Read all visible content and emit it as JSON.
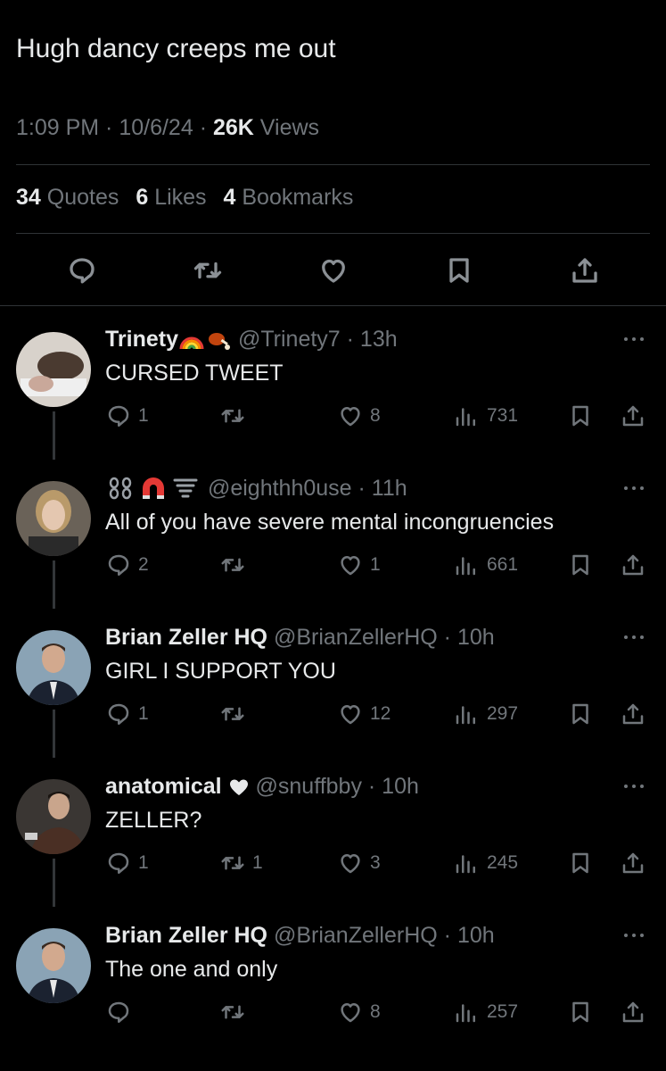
{
  "tweet": {
    "text": "Hugh dancy creeps me out",
    "time": "1:09 PM",
    "date": "10/6/24",
    "views_count": "26K",
    "views_label": "Views",
    "quotes_count": "34",
    "quotes_label": "Quotes",
    "likes_count": "6",
    "likes_label": "Likes",
    "bookmarks_count": "4",
    "bookmarks_label": "Bookmarks"
  },
  "replies": [
    {
      "name": "Trinety",
      "handle": "@Trinety7",
      "age": "13h",
      "text": "CURSED TWEET",
      "replies": "1",
      "reposts": "",
      "likes": "8",
      "views": "731",
      "name_emojis": [
        "rainbow",
        "meat-on-bone"
      ]
    },
    {
      "name": "",
      "handle": "@eighthh0use",
      "age": "11h",
      "text": "All of you have severe mental incongruencies",
      "replies": "2",
      "reposts": "",
      "likes": "1",
      "views": "661",
      "name_emojis": [
        "chains",
        "magnet",
        "tornado"
      ]
    },
    {
      "name": "Brian Zeller HQ",
      "handle": "@BrianZellerHQ",
      "age": "10h",
      "text": "GIRL I SUPPORT YOU",
      "replies": "1",
      "reposts": "",
      "likes": "12",
      "views": "297",
      "name_emojis": []
    },
    {
      "name": "anatomical",
      "handle": "@snuffbby",
      "age": "10h",
      "text": "ZELLER?",
      "replies": "1",
      "reposts": "1",
      "likes": "3",
      "views": "245",
      "name_emojis": [
        "heart"
      ]
    },
    {
      "name": "Brian Zeller HQ",
      "handle": "@BrianZellerHQ",
      "age": "10h",
      "text": "The one and only",
      "replies": "",
      "reposts": "",
      "likes": "8",
      "views": "257",
      "name_emojis": []
    }
  ],
  "colors": {
    "background": "#000000",
    "text": "#e7e9ea",
    "muted": "#71767b",
    "divider": "#2f3336"
  },
  "icons": [
    "reply-icon",
    "repost-icon",
    "like-icon",
    "bookmark-icon",
    "share-icon",
    "views-icon",
    "more-icon"
  ]
}
